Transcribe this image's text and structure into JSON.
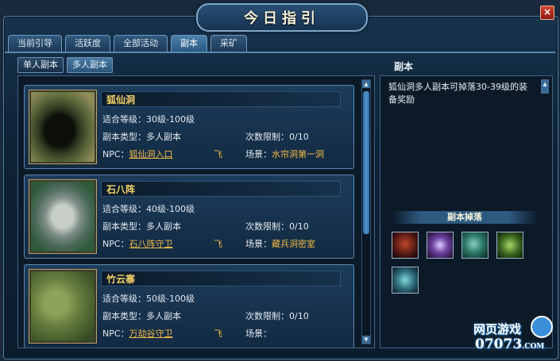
{
  "window": {
    "title": "今日指引",
    "close_label": "×"
  },
  "tabs": [
    "当前引导",
    "活跃度",
    "全部活动",
    "副本",
    "采矿"
  ],
  "subtabs": [
    "单人副本",
    "多人副本"
  ],
  "labels": {
    "level": "适合等级：",
    "type": "副本类型：",
    "limit": "次数限制：",
    "npc": "NPC：",
    "scene": "场景：",
    "fly": "飞"
  },
  "dungeons": [
    {
      "name": "狐仙洞",
      "level": "30级-100级",
      "type": "多人副本",
      "limit": "0/10",
      "npc": "狐仙洞入口",
      "scene": "水帘洞第一洞"
    },
    {
      "name": "石八阵",
      "level": "40级-100级",
      "type": "多人副本",
      "limit": "0/10",
      "npc": "石八阵守卫",
      "scene": "藏兵洞密室"
    },
    {
      "name": "竹云寨",
      "level": "50级-100级",
      "type": "多人副本",
      "limit": "0/10",
      "npc": "万劫谷守卫",
      "scene": ""
    }
  ],
  "detail": {
    "title": "副本",
    "description": "狐仙洞多人副本可掉落30-39级的装备奖励",
    "drops_title": "副本掉落",
    "drop_items": [
      "armor-item",
      "staff-item",
      "shoulder-item",
      "bracer-item",
      "boots-item"
    ]
  },
  "watermark": {
    "line1": "网页游戏",
    "line2": "07073",
    "line2_suffix": ".COM"
  },
  "colors": {
    "accent": "#f0b947",
    "name": "#f6d36a"
  }
}
